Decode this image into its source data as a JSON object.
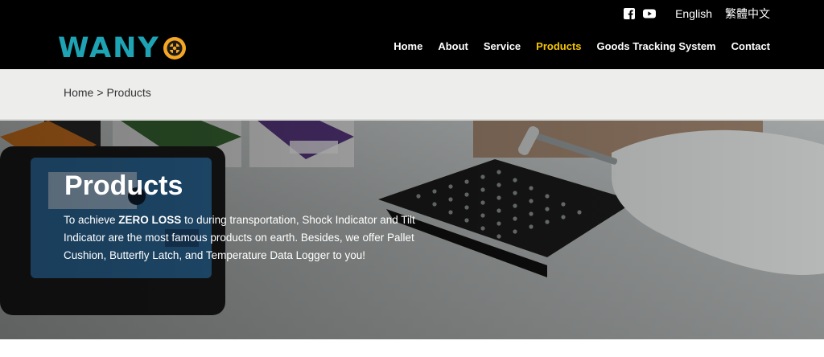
{
  "brand": {
    "name": "WANY"
  },
  "topbar": {
    "icons": [
      "facebook-icon",
      "youtube-icon"
    ],
    "languages": [
      "English",
      "繁體中文"
    ]
  },
  "nav": {
    "items": [
      "Home",
      "About",
      "Service",
      "Products",
      "Goods Tracking System",
      "Contact"
    ],
    "active": "Products"
  },
  "breadcrumb": {
    "home": "Home",
    "separator": ">",
    "current": "Products"
  },
  "hero": {
    "title": "Products",
    "desc_pre": "To achieve ",
    "desc_bold": "ZERO LOSS",
    "desc_post": " to during transportation, Shock Indicator and Tilt Indicator are the most famous products on earth. Besides, we offer Pallet Cushion, Butterfly Latch, and Temperature Data Logger to you!"
  },
  "colors": {
    "header_bg": "#000000",
    "logo_teal": "#1ea3b4",
    "logo_orange": "#f5a623",
    "nav_active": "#f5c500",
    "breadcrumb_bg": "#edeeec"
  }
}
